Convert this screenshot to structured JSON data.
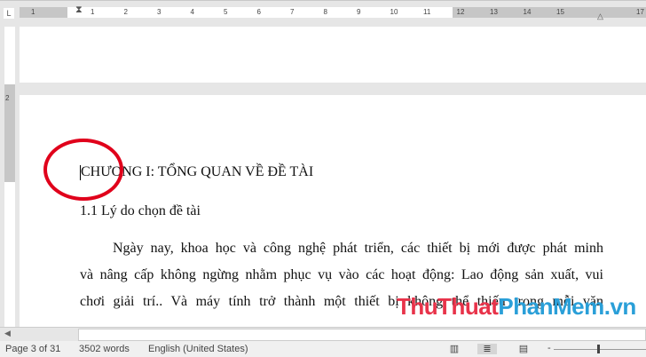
{
  "ruler": {
    "marker": "L",
    "left_ticks": [
      "1"
    ],
    "ticks": [
      "1",
      "2",
      "3",
      "4",
      "5",
      "6",
      "7",
      "8",
      "9",
      "10",
      "11",
      "12",
      "13",
      "14",
      "15"
    ],
    "right_ticks": [
      "17"
    ],
    "vertical_tick": "2"
  },
  "document": {
    "heading": "CHƯƠNG I: TỔNG QUAN VỀ ĐỀ TÀI",
    "subheading": "1.1 Lý do chọn đề tài",
    "paragraph_lines": [
      "Ngày nay, khoa học và công nghệ phát triển, các thiết bị mới được phát minh",
      "và nâng cấp không ngừng nhằm phục vụ vào các hoạt động: Lao động sản xuất, vui",
      "chơi giải trí.. Và máy tính trở thành một thiết bị không thể thiếu trong mỗi văn"
    ]
  },
  "annotation_color": "#e0001b",
  "watermark": {
    "part1": "ThuThuat",
    "part2": "PhanMem",
    "part3": ".vn",
    "color1": "#e8334a",
    "color2": "#2a9fd8"
  },
  "status": {
    "page": "Page 3 of 31",
    "words": "3502 words",
    "language": "English (United States)",
    "zoom_level": 0.5
  },
  "views": [
    {
      "name": "read-mode-icon",
      "active": false
    },
    {
      "name": "print-layout-icon",
      "active": true
    },
    {
      "name": "web-layout-icon",
      "active": false
    }
  ]
}
